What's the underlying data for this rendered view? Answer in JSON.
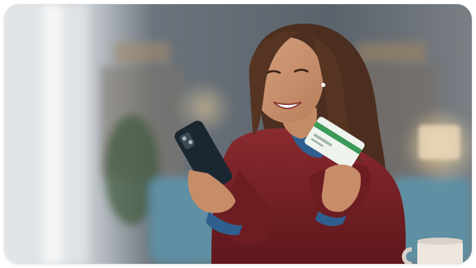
{
  "image": {
    "subject": "photo",
    "colors": {
      "wall": "#5e6670",
      "sweater": "#7a1f24",
      "sofa": "#5f8fa3",
      "card_green": "#3a9a57"
    }
  }
}
